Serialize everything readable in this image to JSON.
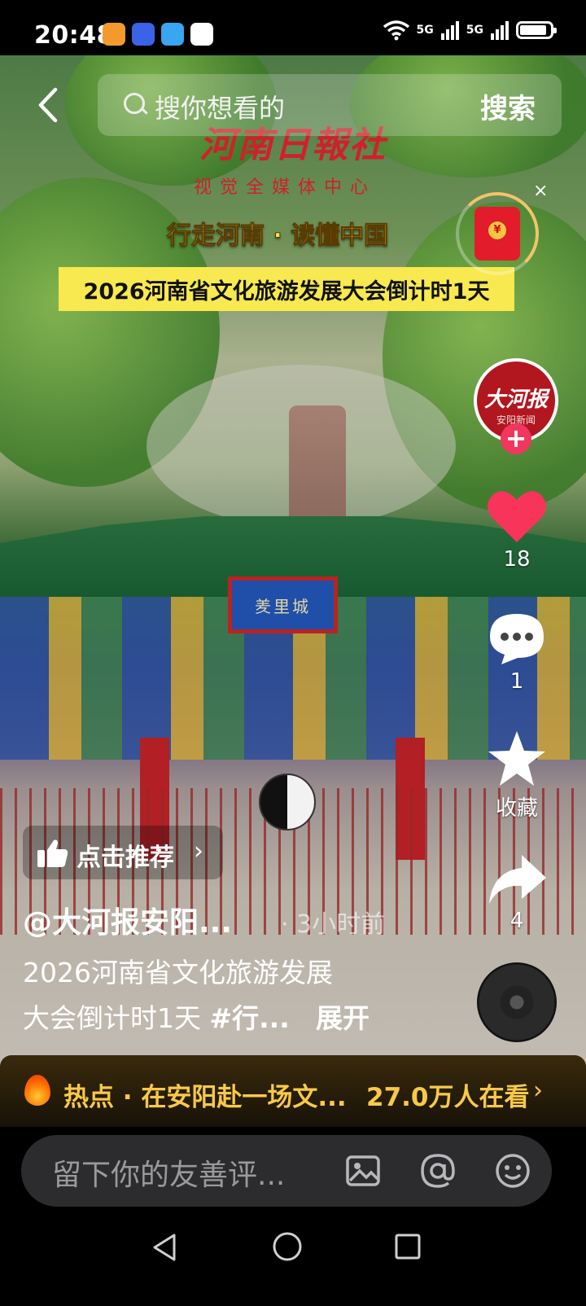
{
  "status_bar": {
    "time": "20:48",
    "signal1": "5G",
    "signal2": "5G",
    "battery_level": 0.9
  },
  "search": {
    "placeholder": "搜你想看的",
    "button_label": "搜索"
  },
  "video_overlay": {
    "logo_title": "河南日報社",
    "logo_subtitle": "视觉全媒体中心",
    "slogan": "行走河南 · 读懂中国",
    "banner": "2026河南省文化旅游发展大会倒计时1天",
    "plaque_text": "羑里城"
  },
  "redpacket": {
    "close_label": "×",
    "seal": "¥"
  },
  "creator_avatar": {
    "line1": "大河报",
    "line2": "安阳新闻"
  },
  "actions": {
    "like_count": "18",
    "comment_count": "1",
    "favorite_label": "收藏",
    "share_count": "4"
  },
  "recommend": {
    "label": "点击推荐",
    "arrow": "›"
  },
  "post": {
    "author": "@大河报安阳...",
    "time_ago": "· 3小时前",
    "desc_line1": "2026河南省文化旅游发展",
    "desc_line2_prefix": "大会倒计时1天 ",
    "desc_hashtag": "#行...",
    "expand_label": "展开"
  },
  "hot": {
    "text": "热点 · 在安阳赴一场文...",
    "viewers": "27.0万人在看",
    "arrow": "›"
  },
  "comment": {
    "placeholder": "留下你的友善评..."
  },
  "colors": {
    "like": "#f8345a",
    "hot_text": "#f8c948",
    "banner_bg": "#f7e94f",
    "follow": "#f2365d"
  }
}
